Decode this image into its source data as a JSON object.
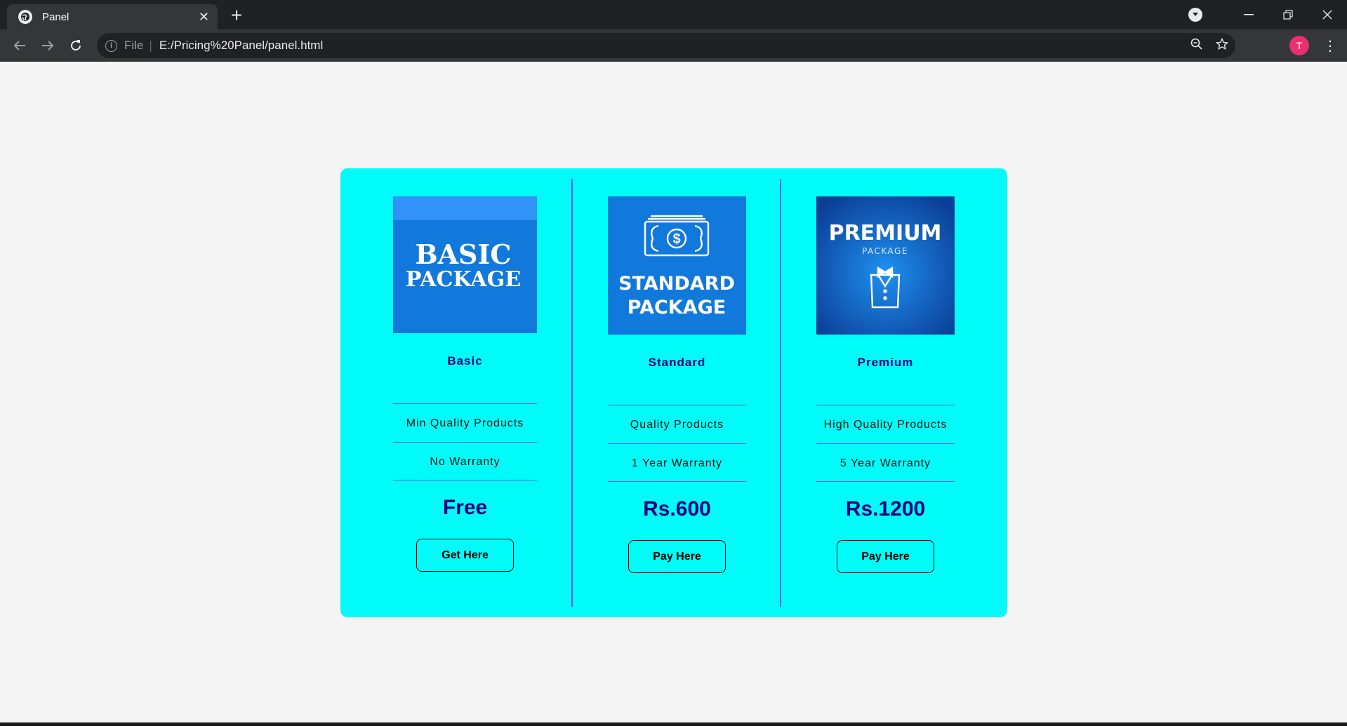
{
  "browser": {
    "tab_title": "Panel",
    "new_tab_label": "+",
    "url_scheme": "File",
    "url": "E:/Pricing%20Panel/panel.html",
    "avatar_letter": "T",
    "avatar_color": "#e8306e"
  },
  "panel": {
    "background": "#00fcf8",
    "accent": "#000080",
    "divider_color": "#6a5fd8",
    "plans": [
      {
        "image": {
          "line1": "BASIC",
          "line2": "PACKAGE",
          "bg": "#1178dc",
          "band": "#3193f7"
        },
        "name": "Basic",
        "features": [
          "Min Quality Products",
          "No Warranty"
        ],
        "price": "Free",
        "button": "Get Here"
      },
      {
        "image": {
          "line1": "STANDARD",
          "line2": "PACKAGE",
          "bg": "#1178dc",
          "icon": "money-icon"
        },
        "name": "Standard",
        "features": [
          "Quality Products",
          "1 Year Warranty"
        ],
        "price": "Rs.600",
        "button": "Pay Here"
      },
      {
        "image": {
          "line1": "PREMIUM",
          "line2": "PACKAGE",
          "bg": "#1565c6",
          "icon": "tuxedo-icon"
        },
        "name": "Premium",
        "features": [
          "High Quality Products",
          "5 Year Warranty"
        ],
        "price": "Rs.1200",
        "button": "Pay Here"
      }
    ]
  }
}
